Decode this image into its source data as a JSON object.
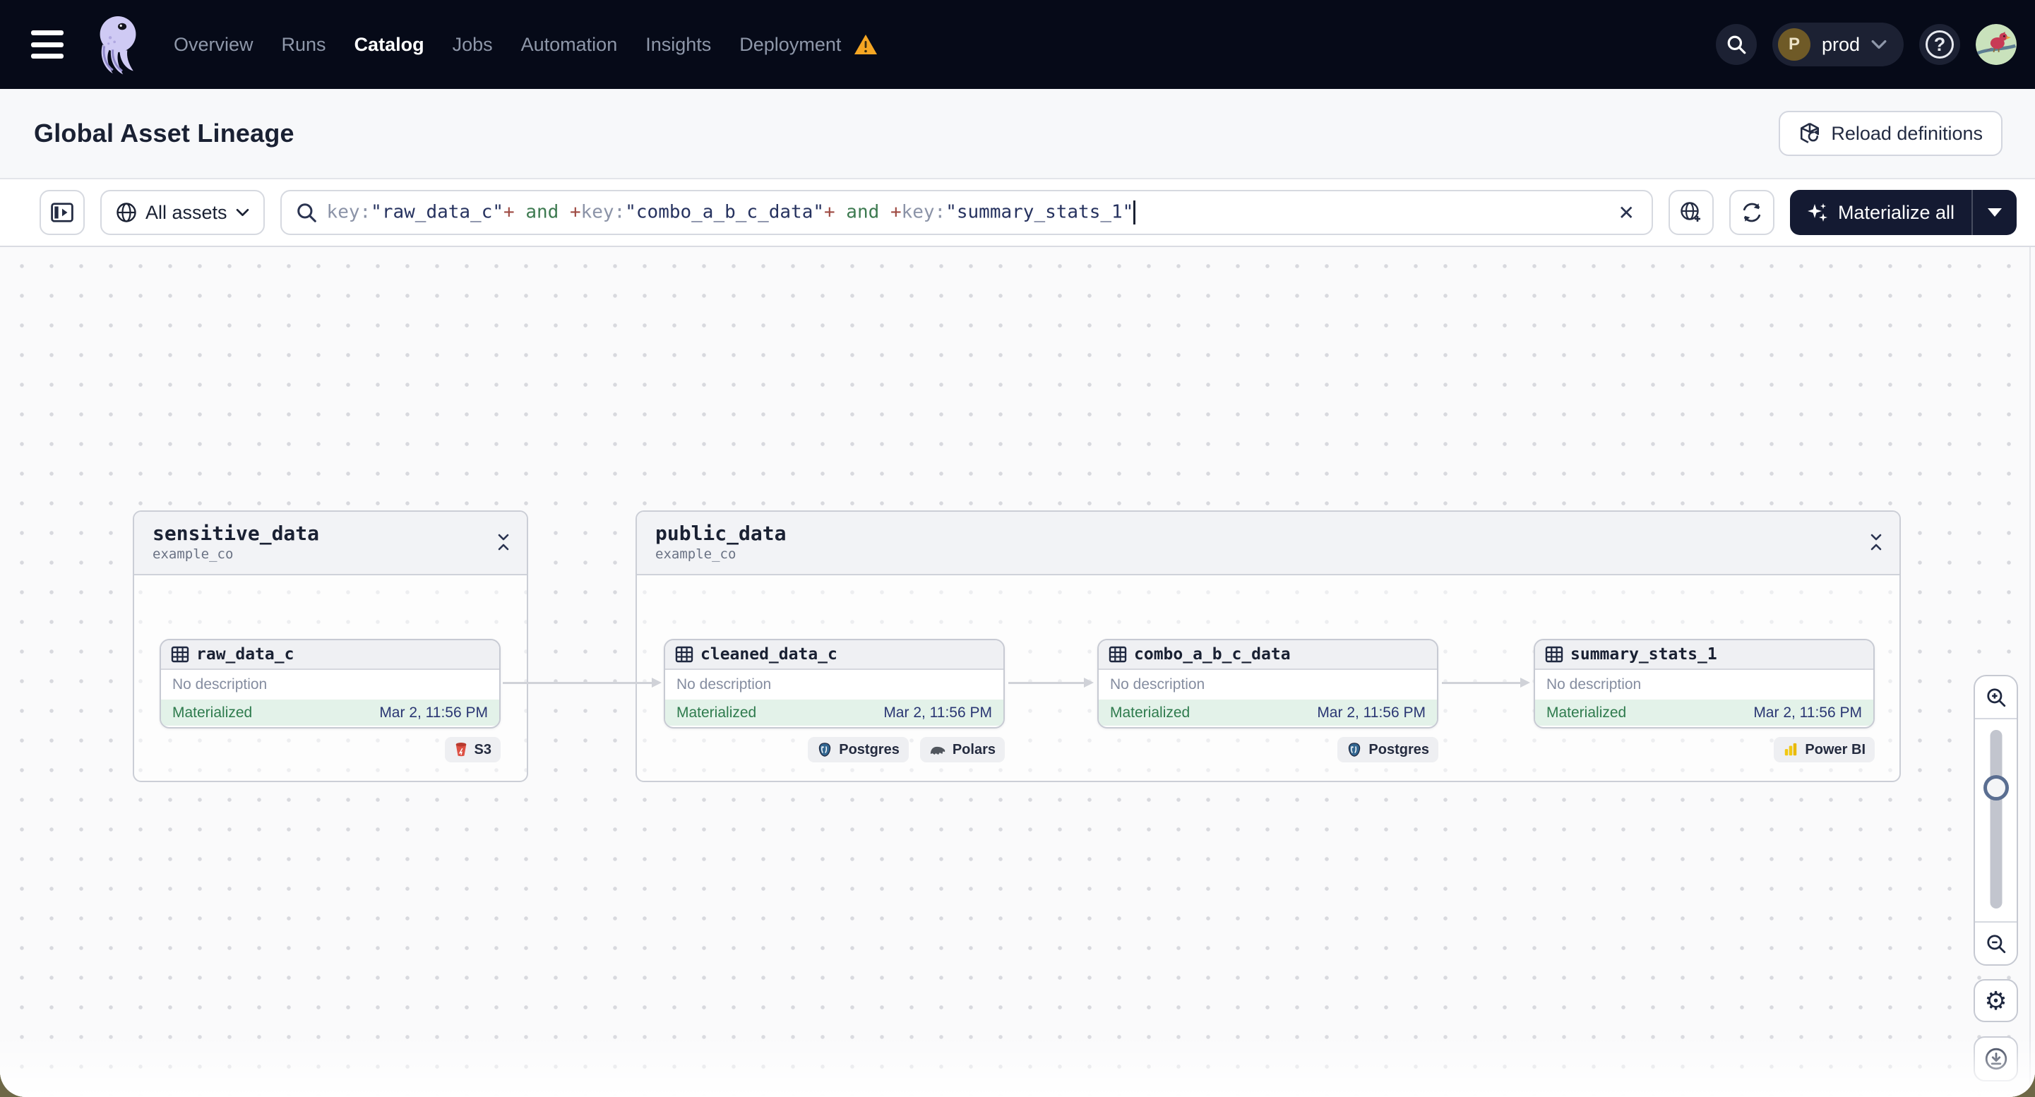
{
  "nav": {
    "items": [
      {
        "label": "Overview"
      },
      {
        "label": "Runs"
      },
      {
        "label": "Catalog"
      },
      {
        "label": "Jobs"
      },
      {
        "label": "Automation"
      },
      {
        "label": "Insights"
      },
      {
        "label": "Deployment"
      }
    ],
    "active_item": "Catalog",
    "env_switcher": {
      "badge": "P",
      "label": "prod"
    },
    "help_glyph": "?"
  },
  "page_header": {
    "title": "Global Asset Lineage",
    "reload_button": "Reload definitions"
  },
  "toolbar": {
    "scope_filter": {
      "label": "All assets"
    },
    "search": {
      "segments": [
        {
          "text": "key:",
          "role": "field"
        },
        {
          "text": "\"raw_data_c\"",
          "role": "string"
        },
        {
          "text": "+",
          "role": "op"
        },
        {
          "text": " and ",
          "role": "bool"
        },
        {
          "text": "+",
          "role": "op"
        },
        {
          "text": "key:",
          "role": "field"
        },
        {
          "text": "\"combo_a_b_c_data\"",
          "role": "string"
        },
        {
          "text": "+",
          "role": "op"
        },
        {
          "text": " and ",
          "role": "bool"
        },
        {
          "text": "+",
          "role": "op"
        },
        {
          "text": "key:",
          "role": "field"
        },
        {
          "text": "\"summary_stats_1\"",
          "role": "string"
        }
      ],
      "clear_glyph": "✕"
    },
    "materialize_button": {
      "label": "Materialize all"
    }
  },
  "graph": {
    "groups": [
      {
        "name": "sensitive_data",
        "repo": "example_co"
      },
      {
        "name": "public_data",
        "repo": "example_co"
      }
    ],
    "assets": [
      {
        "name": "raw_data_c",
        "description": "No description",
        "status": "Materialized",
        "timestamp": "Mar 2, 11:56 PM"
      },
      {
        "name": "cleaned_data_c",
        "description": "No description",
        "status": "Materialized",
        "timestamp": "Mar 2, 11:56 PM"
      },
      {
        "name": "combo_a_b_c_data",
        "description": "No description",
        "status": "Materialized",
        "timestamp": "Mar 2, 11:56 PM"
      },
      {
        "name": "summary_stats_1",
        "description": "No description",
        "status": "Materialized",
        "timestamp": "Mar 2, 11:56 PM"
      }
    ],
    "tags": {
      "s3": "S3",
      "postgres": "Postgres",
      "polars": "Polars",
      "powerbi": "Power BI"
    }
  },
  "zoom_controls": {
    "gear_glyph": "⚙"
  },
  "colors": {
    "navbar_bg": "#060A18",
    "accent_navy": "#141A32",
    "status_green": "#2E7B4D",
    "timestamp_blue": "#2A3673",
    "warning_orange": "#F5A623",
    "query_field": "#8B93A7",
    "query_string": "#26325F",
    "query_op": "#9E4A42",
    "query_bool": "#3D7A50"
  }
}
